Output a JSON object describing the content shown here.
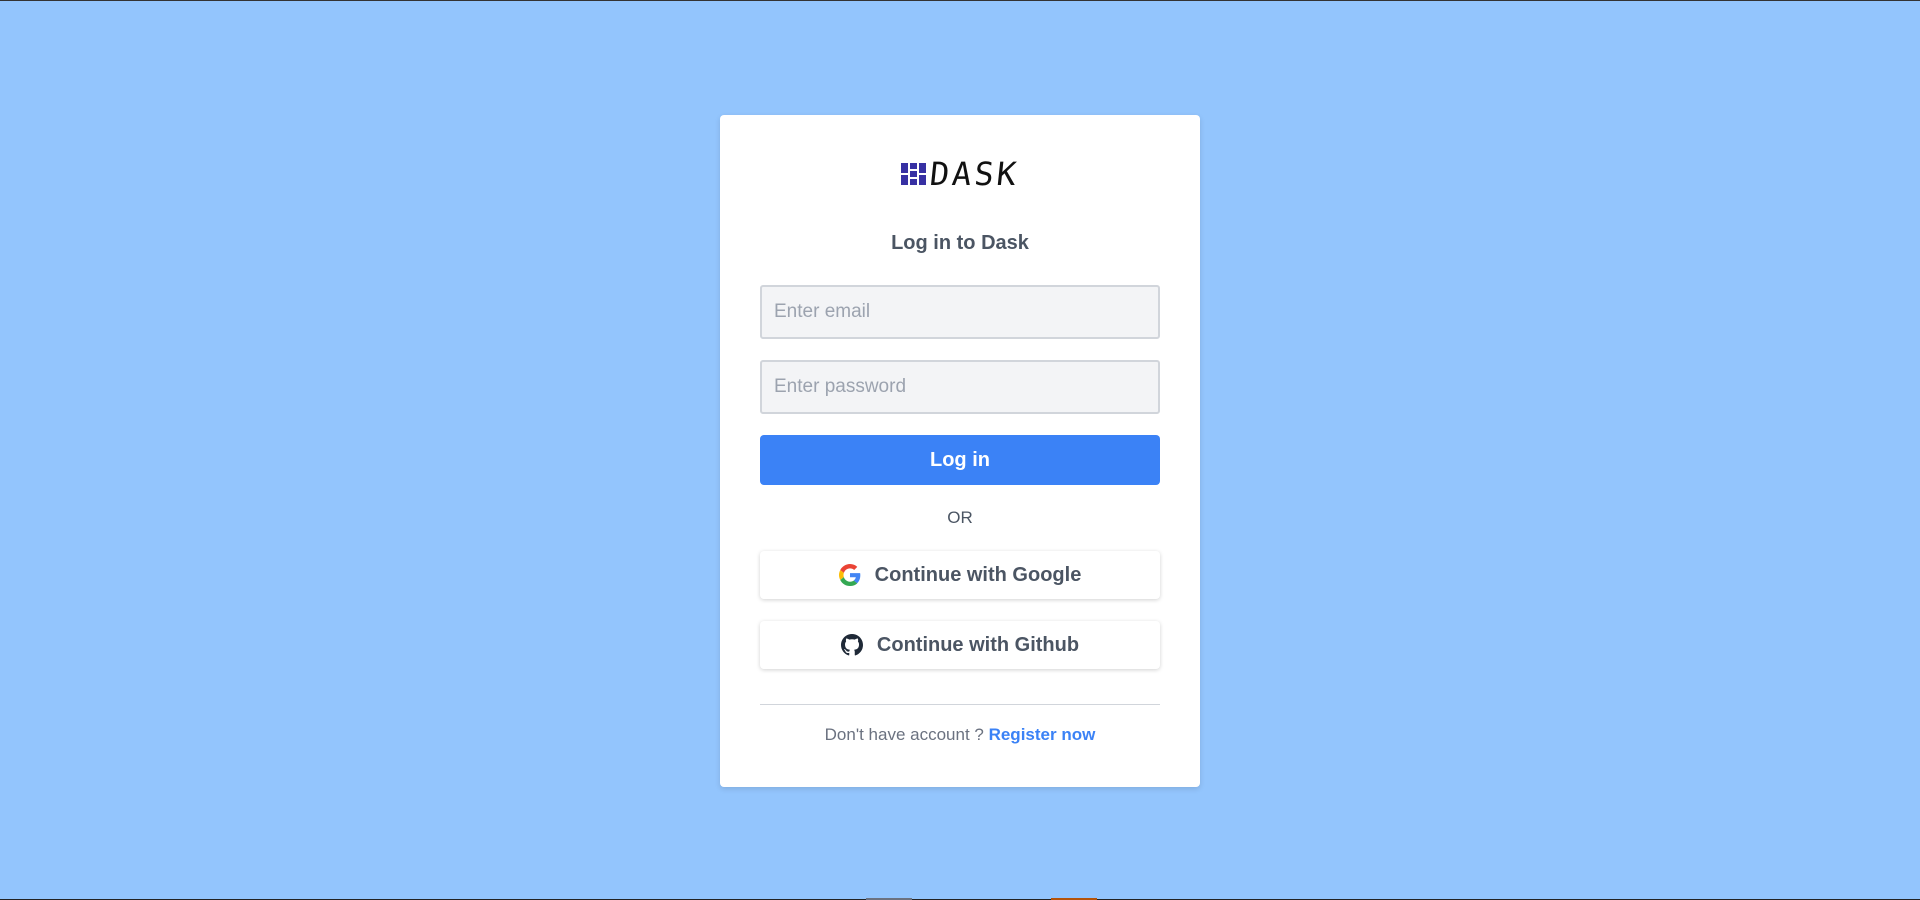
{
  "brand": {
    "logo_text": "DASK",
    "logo_color": "#3730a3"
  },
  "login": {
    "title": "Log in to Dask",
    "email_placeholder": "Enter email",
    "email_value": "",
    "password_placeholder": "Enter password",
    "password_value": "",
    "login_label": "Log in",
    "or_label": "OR",
    "google_label": "Continue with Google",
    "github_label": "Continue with Github",
    "footer_text": "Don't have account ? ",
    "register_label": "Register now"
  },
  "colors": {
    "background": "#93c5fd",
    "primary": "#3b82f6"
  },
  "icons": {
    "logo": "dask-logo-icon",
    "google": "google-icon",
    "github": "github-icon"
  }
}
